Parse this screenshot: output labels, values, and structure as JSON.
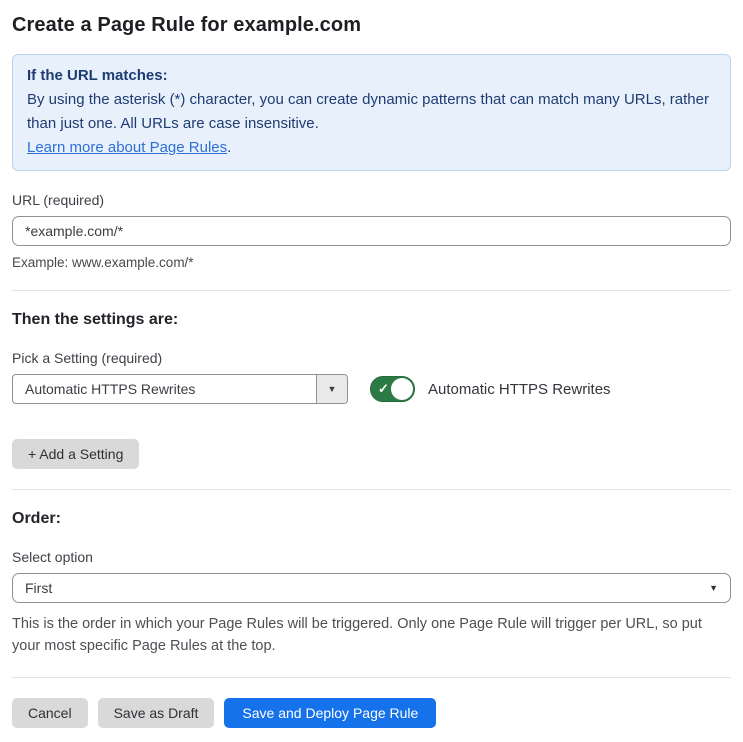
{
  "page": {
    "title": "Create a Page Rule for example.com"
  },
  "info_box": {
    "heading": "If the URL matches:",
    "body": "By using the asterisk (*) character, you can create dynamic patterns that can match many URLs, rather than just one. All URLs are case insensitive.",
    "link_label": "Learn more about Page Rules",
    "link_suffix": "."
  },
  "url_field": {
    "label": "URL (required)",
    "value": "*example.com/*",
    "helper": "Example: www.example.com/*"
  },
  "settings_section": {
    "heading": "Then the settings are:",
    "picker_label": "Pick a Setting (required)",
    "selected_setting": "Automatic HTTPS Rewrites",
    "dropdown_arrow": "▼",
    "toggle_state": "on",
    "toggle_check": "✓",
    "toggle_label": "Automatic HTTPS Rewrites",
    "add_setting_label": "+ Add a Setting"
  },
  "order_section": {
    "heading": "Order:",
    "select_label": "Select option",
    "selected_option": "First",
    "dropdown_arrow": "▼",
    "helper": "This is the order in which your Page Rules will be triggered. Only one Page Rule will trigger per URL, so put your most specific Page Rules at the top."
  },
  "footer": {
    "cancel_label": "Cancel",
    "save_draft_label": "Save as Draft",
    "save_deploy_label": "Save and Deploy Page Rule"
  },
  "colors": {
    "info_box_bg": "#e8f1fb",
    "info_box_border": "#b9d3ee",
    "info_text": "#1e3c72",
    "link_blue": "#2f6fd6",
    "toggle_green": "#2c7a45",
    "primary_button_blue": "#1672eb",
    "secondary_button_gray": "#d9d9d9"
  }
}
